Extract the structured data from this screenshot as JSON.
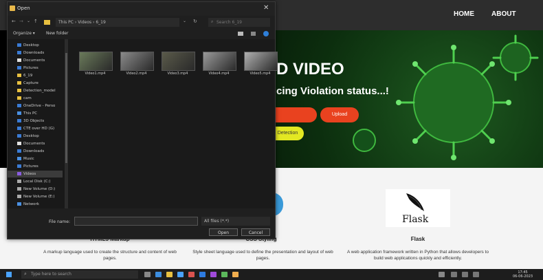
{
  "website": {
    "nav": [
      "HOME",
      "ABOUT"
    ],
    "hero_title": "D VIDEO",
    "hero_subtitle": "cing Violation status...!",
    "buttons": [
      "",
      "Upload",
      "Detection"
    ],
    "cards": [
      {
        "title": "HTML5 Markup",
        "desc": "A markup language used to create the structure and content of web pages."
      },
      {
        "title": "CSS Styling",
        "desc": "Style sheet language used to define the presentation and layout of web pages."
      },
      {
        "title": "Flask",
        "desc": "A web application framework written in Python that allows developers to build web applications quickly and efficiently."
      }
    ],
    "flask_logo_text": "Flask"
  },
  "dialog": {
    "title": "Open",
    "breadcrumb": "This PC  ›  Videos  ›  6_19",
    "search_placeholder": "Search 6_19",
    "organize_label": "Organize ▾",
    "new_folder_label": "New folder",
    "sidebar_items": [
      {
        "label": "Desktop",
        "color": "#3a7bd5"
      },
      {
        "label": "Downloads",
        "color": "#3a7bd5"
      },
      {
        "label": "Documents",
        "color": "#e0e0e0"
      },
      {
        "label": "Pictures",
        "color": "#3a7bd5"
      },
      {
        "label": "6_19",
        "color": "#e8c040"
      },
      {
        "label": "Capture",
        "color": "#e8c040"
      },
      {
        "label": "Detection_model",
        "color": "#e8c040"
      },
      {
        "label": "cam",
        "color": "#e8c040"
      },
      {
        "label": "OneDrive - Perso",
        "color": "#3a7bd5"
      },
      {
        "label": "This PC",
        "color": "#4a90e2"
      },
      {
        "label": "3D Objects",
        "color": "#3a7bd5"
      },
      {
        "label": "CTE over HD (G)",
        "color": "#3a7bd5"
      },
      {
        "label": "Desktop",
        "color": "#3a7bd5"
      },
      {
        "label": "Documents",
        "color": "#e0e0e0"
      },
      {
        "label": "Downloads",
        "color": "#3a7bd5"
      },
      {
        "label": "Music",
        "color": "#4a90e2"
      },
      {
        "label": "Pictures",
        "color": "#3a7bd5"
      },
      {
        "label": "Videos",
        "color": "#8a5ce0"
      },
      {
        "label": "Local Disk (C:)",
        "color": "#aaaaaa"
      },
      {
        "label": "New Volume (D:)",
        "color": "#aaaaaa"
      },
      {
        "label": "New Volume (E:)",
        "color": "#aaaaaa"
      },
      {
        "label": "Network",
        "color": "#4a90e2"
      }
    ],
    "files": [
      "Video1.mp4",
      "Video2.mp4",
      "Video3.mp4",
      "Video4.mp4",
      "Video5.mp4"
    ],
    "file_name_label": "File name:",
    "file_type_value": "All files (*.*)",
    "open_label": "Open",
    "cancel_label": "Cancel"
  },
  "taskbar": {
    "search_placeholder": "Type here to search",
    "time": "17:45",
    "date": "06-06-2023"
  }
}
